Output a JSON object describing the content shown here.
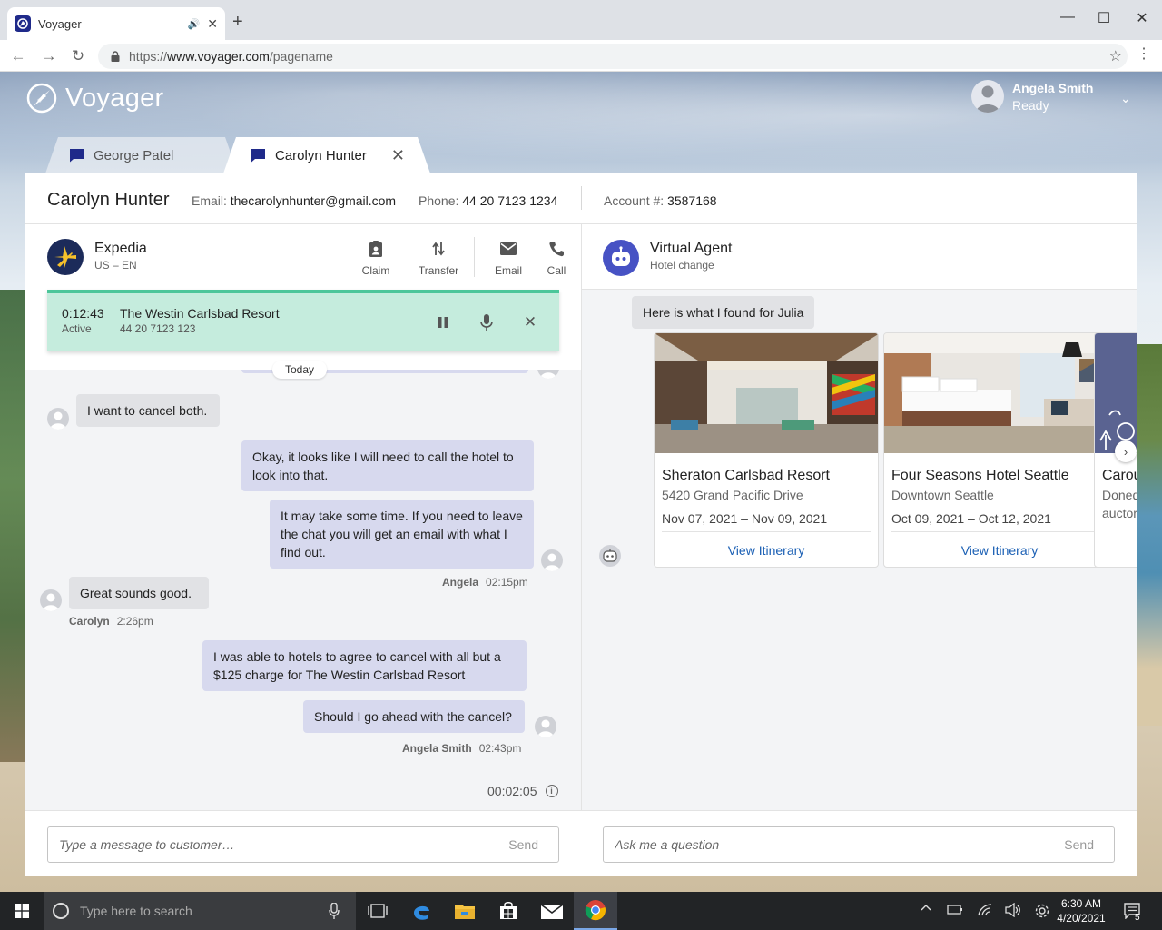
{
  "browser": {
    "tab_title": "Voyager",
    "url_prefix": "https://",
    "url_host": "www.voyager.com",
    "url_path": "/pagename"
  },
  "app": {
    "brand": "Voyager",
    "user": {
      "name": "Angela Smith",
      "status": "Ready"
    }
  },
  "conversation_tabs": [
    {
      "label": "George Patel",
      "active": false
    },
    {
      "label": "Carolyn Hunter",
      "active": true
    }
  ],
  "customer": {
    "name": "Carolyn Hunter",
    "email_label": "Email:",
    "email": "thecarolynhunter@gmail.com",
    "phone_label": "Phone:",
    "phone": "44 20 7123 1234",
    "account_label": "Account #:",
    "account": "3587168"
  },
  "channel": {
    "name": "Expedia",
    "locale": "US – EN",
    "actions": {
      "claim": "Claim",
      "transfer": "Transfer",
      "email": "Email",
      "call": "Call"
    }
  },
  "active_call": {
    "duration": "0:12:43",
    "state": "Active",
    "name": "The Westin Carlsbad Resort",
    "phone": "44 20 7123 123"
  },
  "chat": {
    "date_divider": "Today",
    "messages": [
      {
        "dir": "in",
        "text": "I want to cancel both."
      },
      {
        "dir": "out",
        "text": "Okay, it looks like I will need to call the hotel to look into that."
      },
      {
        "dir": "out",
        "text": "It may take some time. If you need to leave the chat you will get an email with what I find out."
      },
      {
        "dir": "in",
        "text": "Great sounds good."
      },
      {
        "dir": "out",
        "text": "I was able to hotels to agree to cancel with all but a $125 charge for The Westin Carlsbad Resort"
      },
      {
        "dir": "out",
        "text": "Should I go ahead with the cancel?"
      }
    ],
    "meta": [
      {
        "sender": "Angela",
        "time": "02:15pm"
      },
      {
        "sender": "Carolyn",
        "time": "2:26pm"
      },
      {
        "sender": "Angela Smith",
        "time": "02:43pm"
      }
    ],
    "elapsed": "00:02:05"
  },
  "virtual_agent": {
    "name": "Virtual Agent",
    "topic": "Hotel change",
    "intro": "Here is what I found for Julia",
    "hotels": [
      {
        "name": "Sheraton Carlsbad Resort",
        "address": "5420 Grand Pacific Drive",
        "dates": "Nov 07, 2021 – Nov 09, 2021",
        "link": "View Itinerary"
      },
      {
        "name": "Four Seasons Hotel Seattle",
        "address": "Downtown Seattle",
        "dates": "Oct 09, 2021 – Oct 12, 2021",
        "link": "View Itinerary"
      },
      {
        "name": "Carou",
        "address": "Doned",
        "dates": "",
        "link": "",
        "extra_line": "auctor"
      }
    ]
  },
  "inputs": {
    "customer_placeholder": "Type a message to customer…",
    "agent_placeholder": "Ask me a question",
    "send_label": "Send"
  },
  "taskbar": {
    "search_placeholder": "Type here to search",
    "time": "6:30 AM",
    "date": "4/20/2021",
    "notifications": "5"
  },
  "colors": {
    "accent": "#1f2a8a",
    "out_bubble": "#d7d9ee",
    "in_bubble": "#e1e2e5",
    "call_banner": "#c5ecdd",
    "call_banner_border": "#4cc69a",
    "va_brand": "#4752c4",
    "link": "#1a5fb4"
  }
}
